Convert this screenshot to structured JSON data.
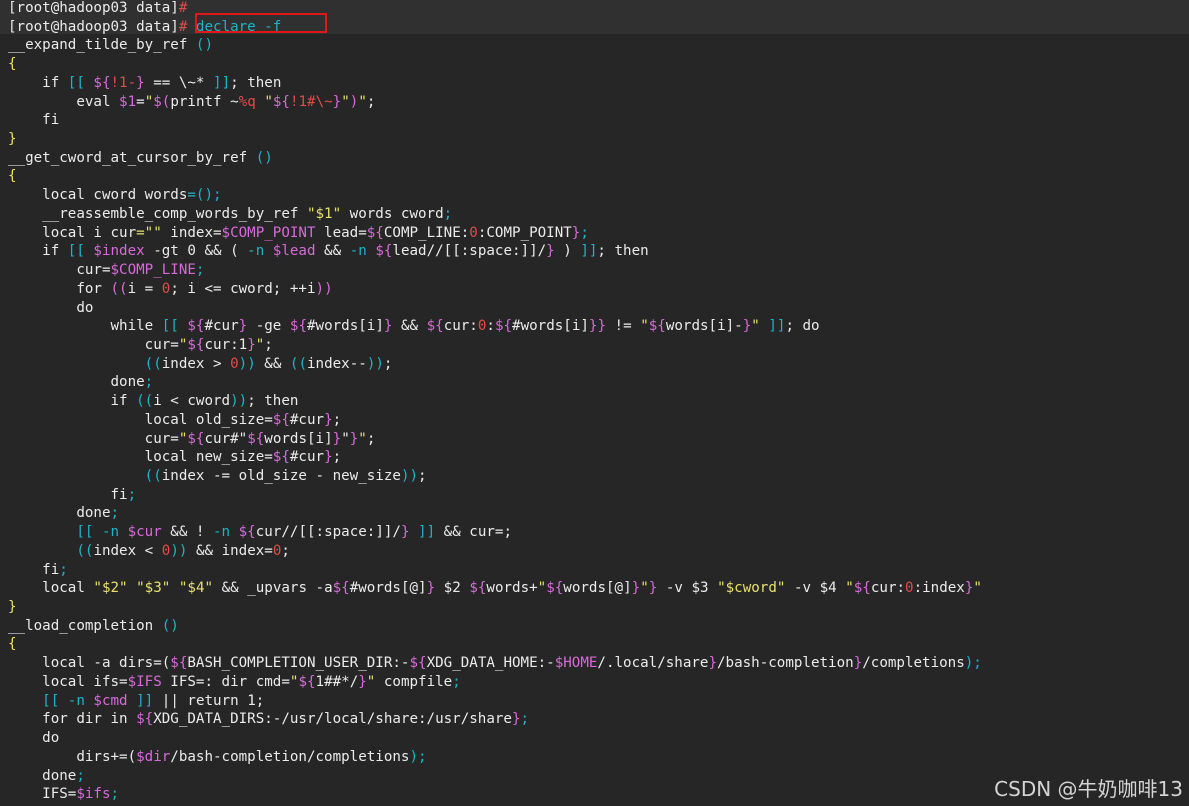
{
  "colors": {
    "background": "#262626",
    "topbar": "#303030",
    "default": "#ebebeb",
    "highlight_box": "#e01818",
    "c": "#1fb3c7",
    "m": "#d76ad9",
    "s": "#e7e16a",
    "r": "#e14b4b",
    "y": "#f0e060"
  },
  "terminal": {
    "lines": [
      [
        [
          "[root@hadoop03 data]",
          ""
        ],
        [
          "#",
          "r"
        ]
      ],
      [
        [
          "[root@hadoop03 data]",
          ""
        ],
        [
          "#",
          "r"
        ],
        [
          " declare -f",
          "c"
        ]
      ],
      [
        [
          "__expand_tilde_by_ref ",
          ""
        ],
        [
          "()",
          "c"
        ]
      ],
      [
        [
          "{",
          "y"
        ]
      ],
      [
        [
          "    if ",
          ""
        ],
        [
          "[[ ",
          "c"
        ],
        [
          "${",
          "m"
        ],
        [
          "!1-",
          "r"
        ],
        [
          "}",
          "m"
        ],
        [
          " == \\~* ",
          ""
        ],
        [
          "]]",
          "c"
        ],
        [
          "; then",
          ""
        ]
      ],
      [
        [
          "        eval ",
          ""
        ],
        [
          "$1",
          "m"
        ],
        [
          "=",
          ""
        ],
        [
          "\"",
          "s"
        ],
        [
          "$(",
          "m"
        ],
        [
          "printf ~",
          ""
        ],
        [
          "%q",
          "r"
        ],
        [
          " ",
          ""
        ],
        [
          "\"",
          "s"
        ],
        [
          "${",
          "m"
        ],
        [
          "!1#\\~",
          "r"
        ],
        [
          "}",
          "m"
        ],
        [
          "\"",
          "s"
        ],
        [
          ")",
          "m"
        ],
        [
          "\"",
          "s"
        ],
        [
          ";",
          ""
        ]
      ],
      [
        [
          "    fi",
          ""
        ]
      ],
      [
        [
          "}",
          "y"
        ]
      ],
      [
        [
          "__get_cword_at_cursor_by_ref ",
          ""
        ],
        [
          "()",
          "c"
        ]
      ],
      [
        [
          "{",
          "y"
        ]
      ],
      [
        [
          "    local cword words",
          ""
        ],
        [
          "=();",
          "c"
        ]
      ],
      [
        [
          "    __reassemble_comp_words_by_ref ",
          ""
        ],
        [
          "\"$1\"",
          "s"
        ],
        [
          " words cword",
          ""
        ],
        [
          ";",
          "c"
        ]
      ],
      [
        [
          "    local i cur",
          ""
        ],
        [
          "=\"\"",
          "s"
        ],
        [
          " index=",
          ""
        ],
        [
          "$COMP_POINT",
          "m"
        ],
        [
          " lead=",
          ""
        ],
        [
          "${",
          "m"
        ],
        [
          "COMP_LINE:",
          ""
        ],
        [
          "0",
          "r"
        ],
        [
          ":COMP_POINT",
          ""
        ],
        [
          "}",
          "m"
        ],
        [
          ";",
          "c"
        ]
      ],
      [
        [
          "    if ",
          ""
        ],
        [
          "[[ ",
          "c"
        ],
        [
          "$index",
          "m"
        ],
        [
          " -gt 0 && ( ",
          ""
        ],
        [
          "-n ",
          "c"
        ],
        [
          "$lead",
          "m"
        ],
        [
          " && ",
          ""
        ],
        [
          "-n ",
          "c"
        ],
        [
          "${",
          "m"
        ],
        [
          "lead//[[:space:]]/",
          ""
        ],
        [
          "}",
          "m"
        ],
        [
          " ) ",
          ""
        ],
        [
          "]]",
          "c"
        ],
        [
          "; then",
          ""
        ]
      ],
      [
        [
          "        cur=",
          ""
        ],
        [
          "$COMP_LINE",
          "m"
        ],
        [
          ";",
          "c"
        ]
      ],
      [
        [
          "        for ",
          ""
        ],
        [
          "((",
          "m"
        ],
        [
          "i = ",
          ""
        ],
        [
          "0",
          "r"
        ],
        [
          "; i <= cword; ++i",
          ""
        ],
        [
          "))",
          "m"
        ]
      ],
      [
        [
          "        do",
          ""
        ]
      ],
      [
        [
          "            while ",
          ""
        ],
        [
          "[[ ",
          "c"
        ],
        [
          "${",
          "m"
        ],
        [
          "#cur",
          ""
        ],
        [
          "}",
          "m"
        ],
        [
          " -ge ",
          ""
        ],
        [
          "${",
          "m"
        ],
        [
          "#words[i]",
          ""
        ],
        [
          "}",
          "m"
        ],
        [
          " && ",
          ""
        ],
        [
          "${",
          "m"
        ],
        [
          "cur:",
          ""
        ],
        [
          "0",
          "r"
        ],
        [
          ":",
          ""
        ],
        [
          "${",
          "m"
        ],
        [
          "#words[i]",
          ""
        ],
        [
          "}}",
          "m"
        ],
        [
          " != ",
          ""
        ],
        [
          "\"",
          "s"
        ],
        [
          "${",
          "m"
        ],
        [
          "words[i]-",
          ""
        ],
        [
          "}",
          "m"
        ],
        [
          "\"",
          "s"
        ],
        [
          " ",
          ""
        ],
        [
          "]]",
          "c"
        ],
        [
          "; do",
          ""
        ]
      ],
      [
        [
          "                cur=",
          ""
        ],
        [
          "\"",
          "s"
        ],
        [
          "${",
          "m"
        ],
        [
          "cur:1",
          ""
        ],
        [
          "}",
          "m"
        ],
        [
          "\"",
          "s"
        ],
        [
          ";",
          ""
        ]
      ],
      [
        [
          "                ",
          ""
        ],
        [
          "((",
          "c"
        ],
        [
          "index > ",
          ""
        ],
        [
          "0",
          "r"
        ],
        [
          "))",
          "c"
        ],
        [
          " && ",
          ""
        ],
        [
          "((",
          "c"
        ],
        [
          "index--",
          ""
        ],
        [
          "))",
          "c"
        ],
        [
          ";",
          ""
        ]
      ],
      [
        [
          "            done",
          ""
        ],
        [
          ";",
          "c"
        ]
      ],
      [
        [
          "            if ",
          ""
        ],
        [
          "((",
          "c"
        ],
        [
          "i < cword",
          ""
        ],
        [
          "))",
          "c"
        ],
        [
          "; then",
          ""
        ]
      ],
      [
        [
          "                local old_size=",
          ""
        ],
        [
          "${",
          "m"
        ],
        [
          "#cur",
          ""
        ],
        [
          "}",
          "m"
        ],
        [
          ";",
          ""
        ]
      ],
      [
        [
          "                cur=",
          ""
        ],
        [
          "\"",
          "s"
        ],
        [
          "${",
          "m"
        ],
        [
          "cur#\"",
          ""
        ],
        [
          "${",
          "m"
        ],
        [
          "words[i]",
          ""
        ],
        [
          "}",
          "m"
        ],
        [
          "\"",
          ""
        ],
        [
          "}",
          "m"
        ],
        [
          "\"",
          "s"
        ],
        [
          ";",
          ""
        ]
      ],
      [
        [
          "                local new_size=",
          ""
        ],
        [
          "${",
          "m"
        ],
        [
          "#cur",
          ""
        ],
        [
          "}",
          "m"
        ],
        [
          ";",
          ""
        ]
      ],
      [
        [
          "                ",
          ""
        ],
        [
          "((",
          "c"
        ],
        [
          "index -= old_size - new_size",
          ""
        ],
        [
          "))",
          "c"
        ],
        [
          ";",
          ""
        ]
      ],
      [
        [
          "            fi",
          ""
        ],
        [
          ";",
          "c"
        ]
      ],
      [
        [
          "        done",
          ""
        ],
        [
          ";",
          "c"
        ]
      ],
      [
        [
          "        ",
          ""
        ],
        [
          "[[ -n ",
          "c"
        ],
        [
          "$cur",
          "m"
        ],
        [
          " && ! ",
          ""
        ],
        [
          "-n ",
          "c"
        ],
        [
          "${",
          "m"
        ],
        [
          "cur//[[:space:]]/",
          ""
        ],
        [
          "}",
          "m"
        ],
        [
          " ",
          ""
        ],
        [
          "]]",
          "c"
        ],
        [
          " && cur=;",
          ""
        ]
      ],
      [
        [
          "        ",
          ""
        ],
        [
          "((",
          "c"
        ],
        [
          "index < ",
          ""
        ],
        [
          "0",
          "r"
        ],
        [
          "))",
          "c"
        ],
        [
          " && index=",
          ""
        ],
        [
          "0",
          "r"
        ],
        [
          ";",
          ""
        ]
      ],
      [
        [
          "    fi",
          ""
        ],
        [
          ";",
          "c"
        ]
      ],
      [
        [
          "    local ",
          ""
        ],
        [
          "\"$2\"",
          "s"
        ],
        [
          " ",
          ""
        ],
        [
          "\"$3\"",
          "s"
        ],
        [
          " ",
          ""
        ],
        [
          "\"$4\"",
          "s"
        ],
        [
          " && _upvars -a",
          ""
        ],
        [
          "${",
          "m"
        ],
        [
          "#words[@]",
          ""
        ],
        [
          "}",
          "m"
        ],
        [
          " $2 ",
          ""
        ],
        [
          "${",
          "m"
        ],
        [
          "words+",
          ""
        ],
        [
          "\"",
          "s"
        ],
        [
          "${",
          "m"
        ],
        [
          "words[@]",
          ""
        ],
        [
          "}",
          "m"
        ],
        [
          "\"",
          "s"
        ],
        [
          "}",
          "m"
        ],
        [
          " -v $3 ",
          ""
        ],
        [
          "\"$cword\"",
          "s"
        ],
        [
          " -v $4 ",
          ""
        ],
        [
          "\"",
          "s"
        ],
        [
          "${",
          "m"
        ],
        [
          "cur:",
          ""
        ],
        [
          "0",
          "r"
        ],
        [
          ":index",
          ""
        ],
        [
          "}",
          "m"
        ],
        [
          "\"",
          "s"
        ]
      ],
      [
        [
          "}",
          "y"
        ]
      ],
      [
        [
          "__load_completion ",
          ""
        ],
        [
          "()",
          "c"
        ]
      ],
      [
        [
          "{",
          "y"
        ]
      ],
      [
        [
          "    local -a dirs=(",
          ""
        ],
        [
          "${",
          "m"
        ],
        [
          "BASH_COMPLETION_USER_DIR:-",
          ""
        ],
        [
          "${",
          "m"
        ],
        [
          "XDG_DATA_HOME:-",
          ""
        ],
        [
          "$HOME",
          "m"
        ],
        [
          "/.local/share",
          ""
        ],
        [
          "}",
          "m"
        ],
        [
          "/bash-completion",
          ""
        ],
        [
          "}",
          "m"
        ],
        [
          "/completions",
          ""
        ],
        [
          ");",
          "c"
        ]
      ],
      [
        [
          "    local ifs=",
          ""
        ],
        [
          "$IFS",
          "m"
        ],
        [
          " IFS=: dir cmd=",
          ""
        ],
        [
          "\"",
          "s"
        ],
        [
          "${",
          "m"
        ],
        [
          "1##*/",
          ""
        ],
        [
          "}",
          "m"
        ],
        [
          "\"",
          "s"
        ],
        [
          " compfile",
          ""
        ],
        [
          ";",
          "c"
        ]
      ],
      [
        [
          "    ",
          ""
        ],
        [
          "[[ -n ",
          "c"
        ],
        [
          "$cmd",
          "m"
        ],
        [
          " ",
          ""
        ],
        [
          "]]",
          "c"
        ],
        [
          " || return 1;",
          ""
        ]
      ],
      [
        [
          "    for dir in ",
          ""
        ],
        [
          "${",
          "m"
        ],
        [
          "XDG_DATA_DIRS:-/usr/local/share:/usr/share",
          ""
        ],
        [
          "}",
          "m"
        ],
        [
          ";",
          "c"
        ]
      ],
      [
        [
          "    do",
          ""
        ]
      ],
      [
        [
          "        dirs+=(",
          ""
        ],
        [
          "$dir",
          "m"
        ],
        [
          "/bash-completion/completions",
          ""
        ],
        [
          ");",
          "c"
        ]
      ],
      [
        [
          "    done",
          ""
        ],
        [
          ";",
          "c"
        ]
      ],
      [
        [
          "    IFS=",
          ""
        ],
        [
          "$ifs",
          "m"
        ],
        [
          ";",
          "c"
        ]
      ]
    ]
  },
  "watermark": "CSDN @牛奶咖啡13"
}
